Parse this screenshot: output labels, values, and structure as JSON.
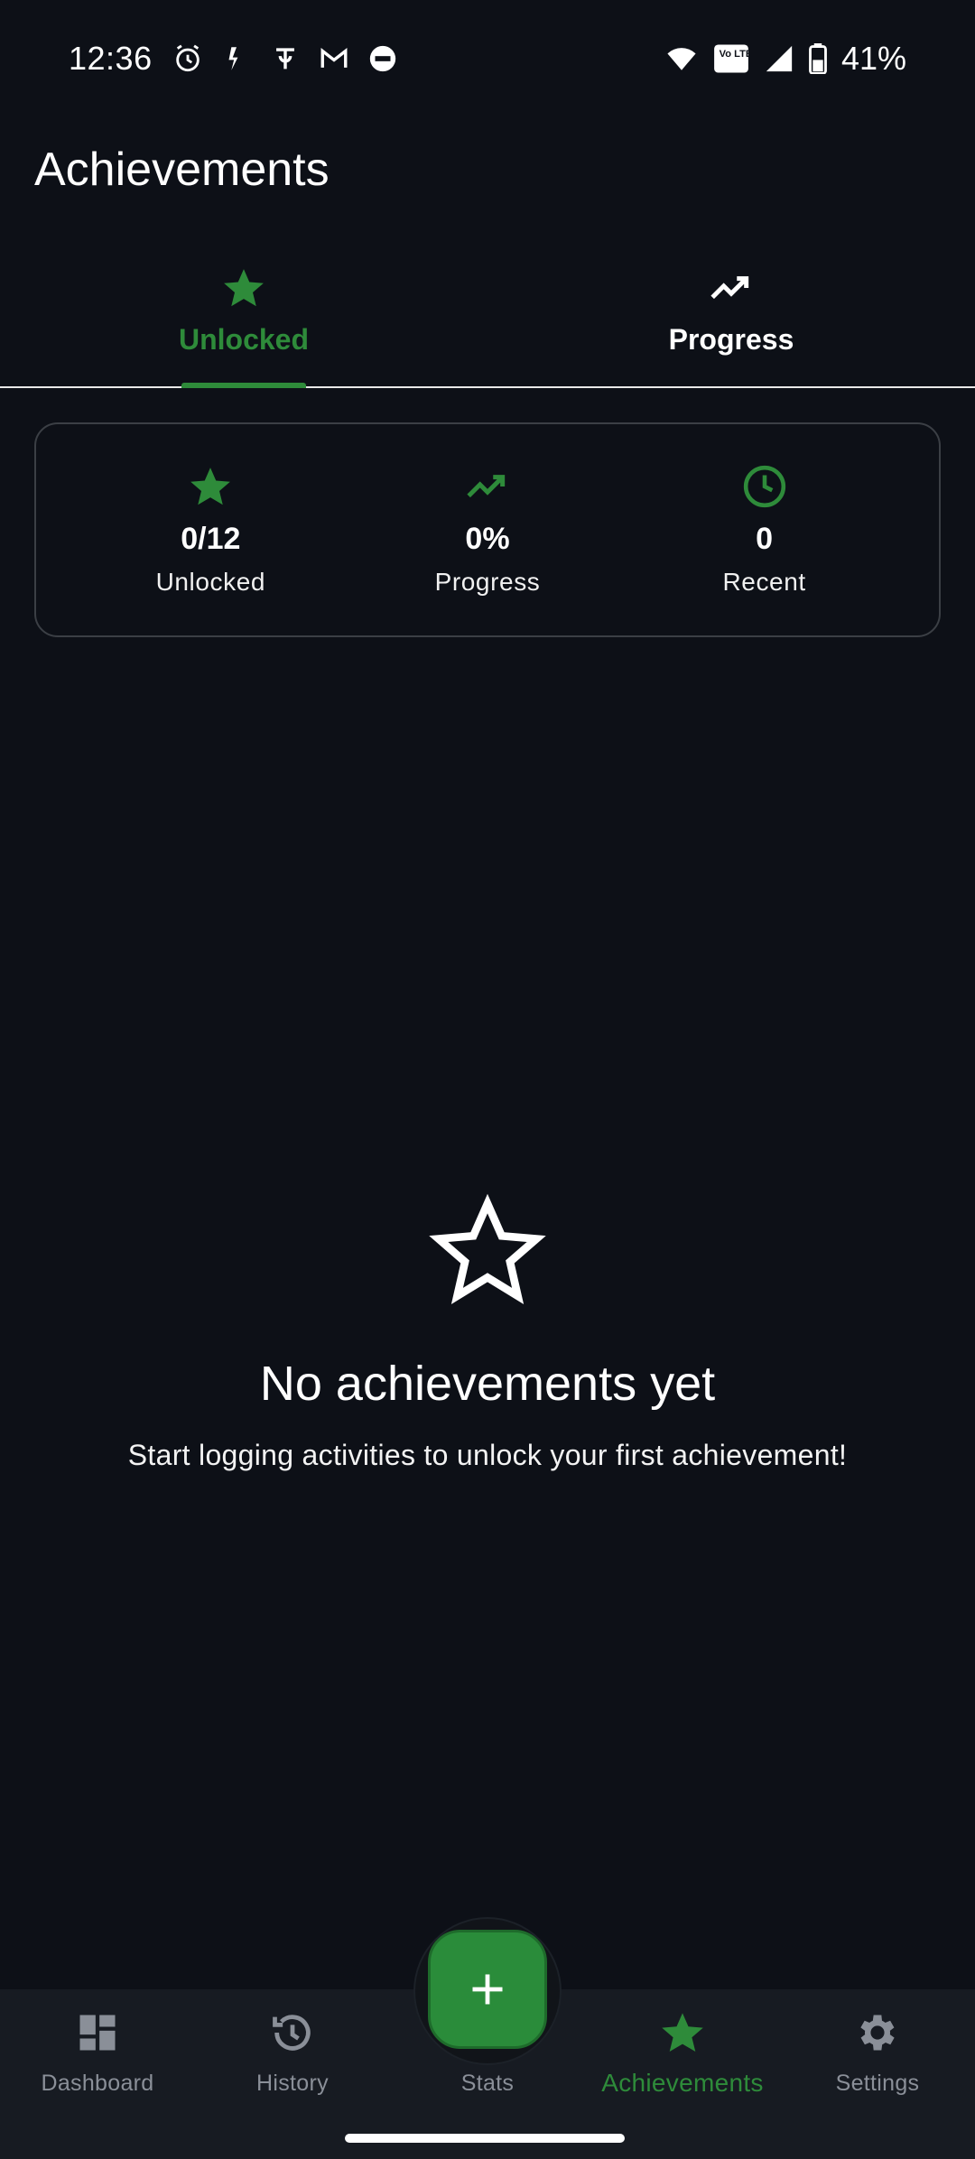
{
  "status_bar": {
    "time": "12:36",
    "battery": "41%",
    "volte_label": "Vo LTE",
    "icons_left": [
      "alarm-icon",
      "notification-icon",
      "payment-icon",
      "gmail-icon",
      "app-icon"
    ],
    "icons_right": [
      "wifi-icon",
      "volte-icon",
      "signal-icon",
      "battery-icon"
    ]
  },
  "app_bar": {
    "title": "Achievements"
  },
  "tabs": [
    {
      "label": "Unlocked",
      "icon": "star-icon",
      "active": true
    },
    {
      "label": "Progress",
      "icon": "trending-up-icon",
      "active": false
    }
  ],
  "summary": {
    "stats": [
      {
        "value": "0/12",
        "label": "Unlocked",
        "icon": "star-icon"
      },
      {
        "value": "0%",
        "label": "Progress",
        "icon": "trending-up-icon"
      },
      {
        "value": "0",
        "label": "Recent",
        "icon": "clock-icon"
      }
    ]
  },
  "empty_state": {
    "icon": "star-outline-icon",
    "title": "No achievements yet",
    "subtitle": "Start logging activities to unlock your first achievement!"
  },
  "bottom_nav": {
    "items": [
      {
        "label": "Dashboard",
        "icon": "dashboard-icon"
      },
      {
        "label": "History",
        "icon": "history-icon"
      },
      {
        "label": "Stats",
        "icon": "add-icon"
      },
      {
        "label": "Achievements",
        "icon": "star-icon",
        "active": true
      },
      {
        "label": "Settings",
        "icon": "gear-icon"
      }
    ]
  },
  "colors": {
    "background": "#0d1017",
    "accent": "#2e8b3a",
    "nav_background": "#171b22",
    "card_border": "#3b3f45",
    "inactive": "#8a8f98"
  }
}
